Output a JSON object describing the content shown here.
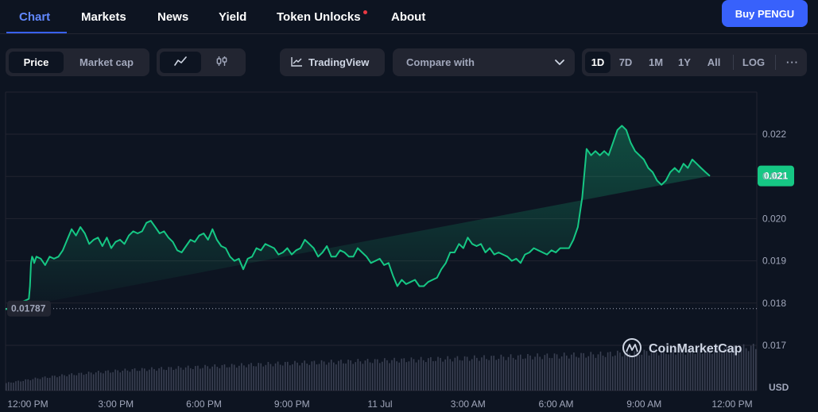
{
  "nav": {
    "tabs": [
      {
        "label": "Chart",
        "active": true
      },
      {
        "label": "Markets"
      },
      {
        "label": "News"
      },
      {
        "label": "Yield"
      },
      {
        "label": "Token Unlocks",
        "notification": true
      },
      {
        "label": "About"
      }
    ],
    "buy_label": "Buy PENGU"
  },
  "controls": {
    "metric": {
      "options": [
        "Price",
        "Market cap"
      ],
      "selected": "Price"
    },
    "chart_type": {
      "options": [
        "line-chart-icon",
        "candlestick-icon"
      ],
      "selected": "line-chart-icon"
    },
    "tradingview_label": "TradingView",
    "compare_placeholder": "Compare with",
    "ranges": [
      "1D",
      "7D",
      "1M",
      "1Y",
      "All"
    ],
    "selected_range": "1D",
    "log_label": "LOG",
    "more_label": "···"
  },
  "colors": {
    "accent": "#3861fb",
    "line": "#16c784",
    "background": "#0d1421"
  },
  "watermark": "CoinMarketCap",
  "chart_data": {
    "type": "area",
    "currency": "USD",
    "ylim": [
      0.0167,
      0.0229
    ],
    "y_ticks": [
      "0.022",
      "0.021",
      "0.020",
      "0.019",
      "0.018",
      "0.017"
    ],
    "y_tick_values": [
      0.022,
      0.021,
      0.02,
      0.019,
      0.018,
      0.017
    ],
    "x_tick_labels": [
      "12:00 PM",
      "3:00 PM",
      "6:00 PM",
      "9:00 PM",
      "11 Jul",
      "3:00 AM",
      "6:00 AM",
      "9:00 AM",
      "12:00 PM"
    ],
    "x_tick_hours": [
      0,
      3,
      6,
      9,
      12,
      15,
      18,
      21,
      24
    ],
    "x_range_hours": [
      0,
      24.4
    ],
    "open_price_label": "0.01787",
    "open_price": 0.01787,
    "current_price_label": "0.021",
    "current_price": 0.02101,
    "price_series": {
      "x_hours": [
        0,
        0.15,
        0.3,
        0.45,
        0.6,
        0.75,
        0.9,
        1.05,
        1.2,
        1.35,
        1.5,
        1.65,
        1.8,
        1.95,
        2.1,
        2.25,
        2.4,
        2.55,
        2.7,
        2.85,
        3.0,
        3.15,
        3.3,
        3.45,
        3.6,
        3.75,
        3.9,
        4.05,
        4.2,
        4.35,
        4.5,
        4.65,
        4.8,
        4.95,
        5.1,
        5.25,
        5.4,
        5.55,
        5.7,
        5.85,
        6.0,
        6.15,
        6.3,
        6.45,
        6.6,
        6.75,
        6.9,
        7.05,
        7.2,
        7.35,
        7.5,
        7.65,
        7.8,
        7.95,
        8.1,
        8.25,
        8.4,
        8.55,
        8.7,
        8.85,
        9.0,
        9.15,
        9.3,
        9.45,
        9.6,
        9.75,
        9.9,
        10.05,
        10.2,
        10.35,
        10.5,
        10.65,
        10.8,
        10.95,
        11.1,
        11.25,
        11.4,
        11.55,
        11.7,
        11.85,
        12.0,
        12.15,
        12.3,
        12.45,
        12.6,
        12.75,
        12.9,
        13.05,
        13.2,
        13.35,
        13.5,
        13.65,
        13.8,
        13.95,
        14.1,
        14.25,
        14.4,
        14.55,
        14.7,
        14.85,
        15.0,
        15.15,
        15.3,
        15.45,
        15.6,
        15.75,
        15.9,
        16.05,
        16.2,
        16.35,
        16.5,
        16.65,
        16.8,
        16.95,
        17.1,
        17.25,
        17.4,
        17.55,
        17.7,
        17.85,
        18.0,
        18.15,
        18.3,
        18.45,
        18.6,
        18.75,
        18.9,
        19.05,
        19.2,
        19.35,
        19.5,
        19.65,
        19.8,
        19.95,
        20.1,
        20.25,
        20.4,
        20.55,
        20.7,
        20.85,
        21.0,
        21.15,
        21.3,
        21.45,
        21.6,
        21.75,
        21.9,
        22.05,
        22.2,
        22.35,
        22.5,
        22.65,
        22.8,
        22.95,
        23.1,
        23.25,
        23.4,
        23.55,
        23.7,
        23.85,
        24.0,
        24.15,
        24.3
      ],
      "price": [
        0.01785,
        0.0181,
        0.0184,
        0.01895,
        0.0191,
        0.01905,
        0.01895,
        0.0191,
        0.01905,
        0.0189,
        0.0191,
        0.01905,
        0.0191,
        0.01925,
        0.0195,
        0.01975,
        0.0196,
        0.0198,
        0.01965,
        0.0194,
        0.0195,
        0.01955,
        0.01935,
        0.01955,
        0.0193,
        0.01945,
        0.0195,
        0.0194,
        0.0196,
        0.0197,
        0.01965,
        0.0197,
        0.0199,
        0.01995,
        0.0198,
        0.01965,
        0.0197,
        0.01955,
        0.01945,
        0.01925,
        0.0192,
        0.01935,
        0.0195,
        0.01945,
        0.0196,
        0.01965,
        0.0195,
        0.01975,
        0.0195,
        0.01935,
        0.0193,
        0.0191,
        0.019,
        0.01905,
        0.0188,
        0.01905,
        0.0191,
        0.0193,
        0.01925,
        0.0194,
        0.01935,
        0.0193,
        0.01915,
        0.0192,
        0.0193,
        0.01915,
        0.01925,
        0.0193,
        0.0195,
        0.0194,
        0.0193,
        0.0191,
        0.0192,
        0.01935,
        0.0191,
        0.0191,
        0.01925,
        0.0192,
        0.0191,
        0.0191,
        0.0193,
        0.0192,
        0.0191,
        0.01895,
        0.019,
        0.01905,
        0.0189,
        0.01895,
        0.01865,
        0.0184,
        0.01855,
        0.01845,
        0.0185,
        0.01855,
        0.0184,
        0.0184,
        0.0185,
        0.01855,
        0.0186,
        0.0188,
        0.01895,
        0.0192,
        0.0192,
        0.0194,
        0.0193,
        0.01955,
        0.0194,
        0.01935,
        0.0194,
        0.0192,
        0.0193,
        0.01915,
        0.0192,
        0.01915,
        0.0191,
        0.019,
        0.01905,
        0.01895,
        0.01915,
        0.0192,
        0.0193,
        0.01925,
        0.0192,
        0.01915,
        0.01925,
        0.0192,
        0.0193,
        0.0193,
        0.0193,
        0.0195,
        0.0198,
        0.0205,
        0.02165,
        0.0215,
        0.0216,
        0.0215,
        0.0216,
        0.0215,
        0.0218,
        0.0221,
        0.0222,
        0.0221,
        0.0218,
        0.0216,
        0.0215,
        0.0214,
        0.0212,
        0.0211,
        0.0209,
        0.0208,
        0.0209,
        0.0211,
        0.0212,
        0.0211,
        0.0213,
        0.0212,
        0.0214,
        0.0213,
        0.0212,
        0.0211,
        0.02101
      ]
    },
    "volume_series": {
      "x_range_hours": [
        0,
        24.2
      ],
      "relative_heights": [
        0.17,
        0.28,
        0.36,
        0.42,
        0.47,
        0.5,
        0.53,
        0.56,
        0.59,
        0.62,
        0.64,
        0.66,
        0.68,
        0.7,
        0.72,
        0.74,
        0.76,
        0.78,
        0.8,
        0.82,
        0.86,
        0.88,
        0.9,
        0.93,
        1.0
      ]
    }
  }
}
